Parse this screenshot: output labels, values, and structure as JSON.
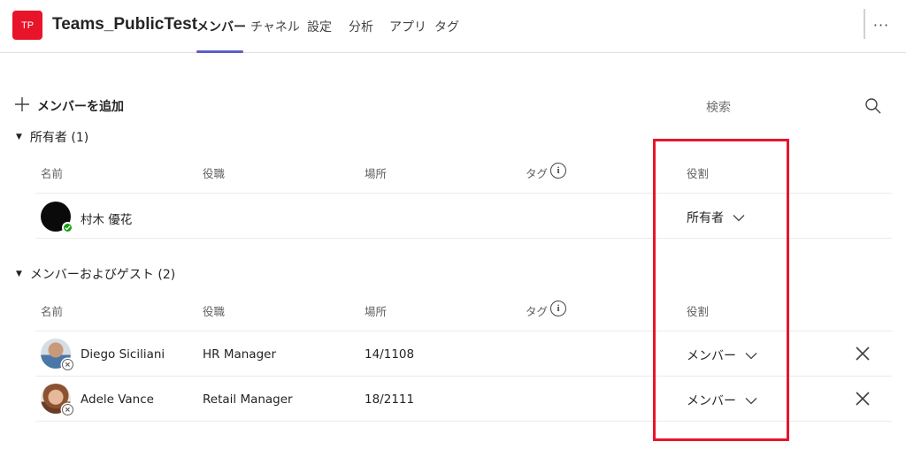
{
  "header": {
    "team_initials": "TP",
    "team_name": "Teams_PublicTest",
    "tabs": [
      {
        "label": "メンバー",
        "active": true
      },
      {
        "label": "チャネル",
        "active": false
      },
      {
        "label": "設定",
        "active": false
      },
      {
        "label": "分析",
        "active": false
      },
      {
        "label": "アプリ",
        "active": false
      },
      {
        "label": "タグ",
        "active": false
      }
    ],
    "more_label": "···"
  },
  "toolbar": {
    "add_member_label": "メンバーを追加",
    "search_placeholder": "検索"
  },
  "columns": {
    "name": "名前",
    "title": "役職",
    "location": "場所",
    "tags": "タグ",
    "role": "役割"
  },
  "owners": {
    "section_label": "所有者 (1)",
    "members": [
      {
        "name": "村木 優花",
        "title": "",
        "location": "",
        "role": "所有者",
        "status": "available"
      }
    ]
  },
  "guests": {
    "section_label": "メンバーおよびゲスト (2)",
    "members": [
      {
        "name": "Diego Siciliani",
        "title": "HR Manager",
        "location": "14/1108",
        "role": "メンバー",
        "status": "offline"
      },
      {
        "name": "Adele Vance",
        "title": "Retail Manager",
        "location": "18/2111",
        "role": "メンバー",
        "status": "offline"
      }
    ]
  },
  "colors": {
    "accent": "#5b5fc7",
    "team_avatar": "#e8152a",
    "highlight": "#e8152a",
    "available": "#13a10e"
  }
}
